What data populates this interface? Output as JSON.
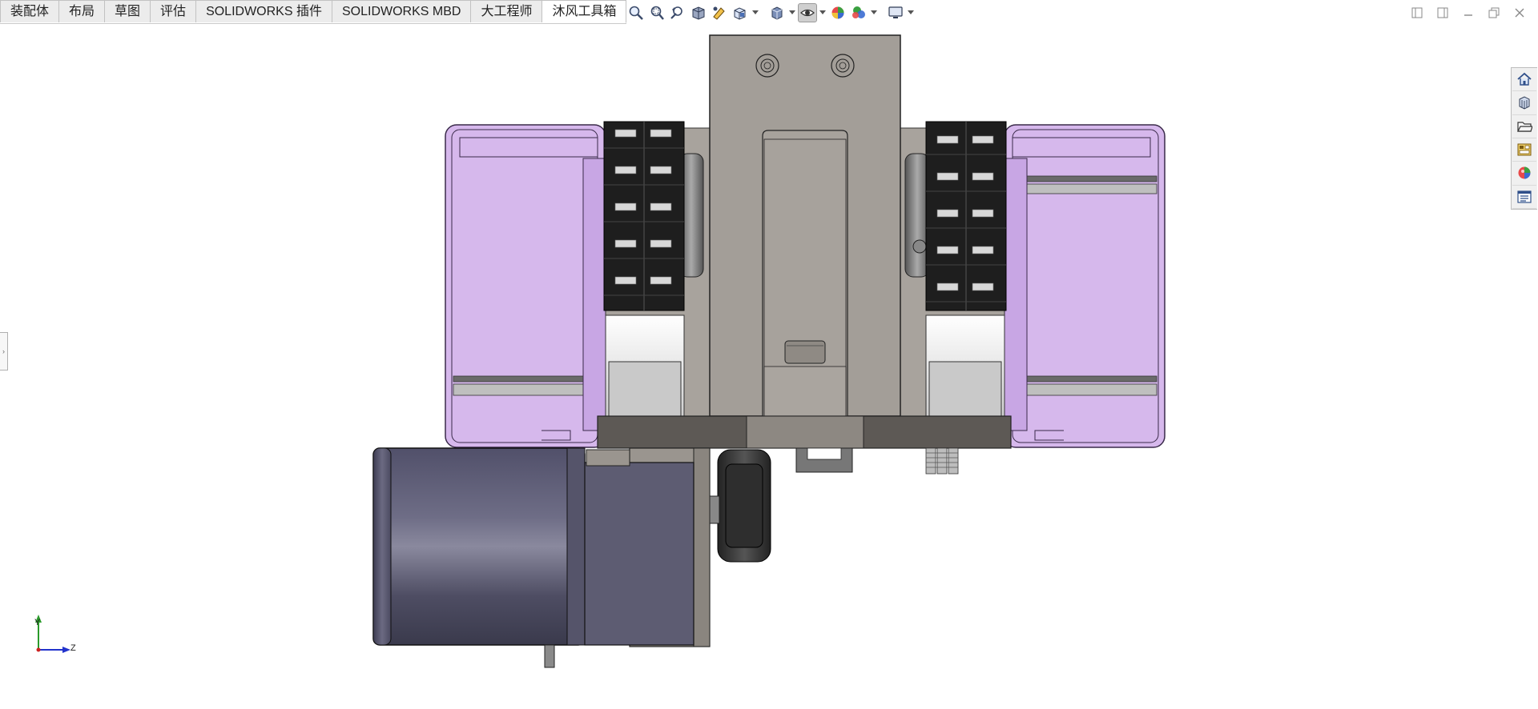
{
  "tabs": [
    {
      "label": "装配体",
      "active": false
    },
    {
      "label": "布局",
      "active": false
    },
    {
      "label": "草图",
      "active": false
    },
    {
      "label": "评估",
      "active": false
    },
    {
      "label": "SOLIDWORKS 插件",
      "active": false
    },
    {
      "label": "SOLIDWORKS MBD",
      "active": false
    },
    {
      "label": "大工程师",
      "active": false
    },
    {
      "label": "沐风工具箱",
      "active": true
    }
  ],
  "hud_toolbar": {
    "icons": [
      "zoom-to-fit-icon",
      "zoom-to-area-icon",
      "previous-view-icon",
      "section-view-icon",
      "dynamic-annotation-icon",
      "view-orientation-icon",
      "display-style-icon",
      "hide-show-items-icon",
      "edit-appearance-icon",
      "apply-scene-icon",
      "view-settings-icon"
    ]
  },
  "task_pane": {
    "icons": [
      "home-icon",
      "design-library-icon",
      "file-explorer-icon",
      "view-palette-icon",
      "appearances-icon",
      "custom-properties-icon"
    ]
  },
  "triad": {
    "y_label": "Y",
    "z_label": "Z"
  },
  "colors": {
    "housing_purple": "#d6b8ec",
    "plate_gray": "#a39e98",
    "motor_gray": "#5a596a",
    "dark_base": "#5d5955"
  }
}
